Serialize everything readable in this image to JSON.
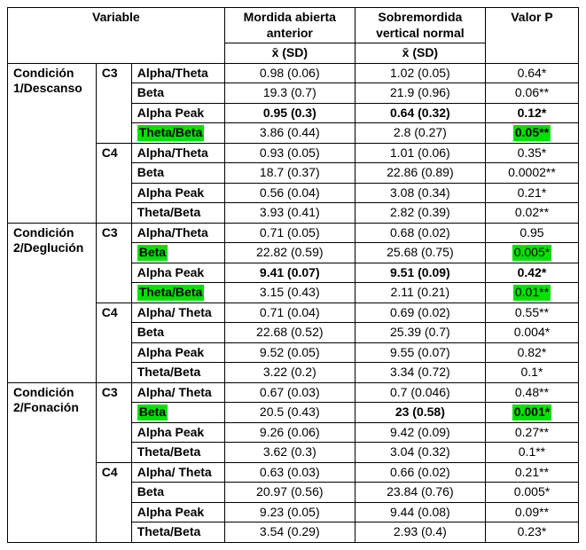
{
  "header": {
    "variable": "Variable",
    "group1_title": "Mordida abierta anterior",
    "group2_title": "Sobremordida vertical normal",
    "pvalue": "Valor P",
    "stat": "x̄ (SD)"
  },
  "conditions": [
    {
      "name": "Condición 1/Descanso",
      "electrodes": [
        {
          "name": "C3",
          "rows": [
            {
              "metric": "Alpha/Theta",
              "v1": "0.98 (0.06)",
              "v2": "1.02 (0.05)",
              "p": "0.64*"
            },
            {
              "metric": "Beta",
              "v1": "19.3 (0.7)",
              "v2": "21.9 (0.96)",
              "p": "0.06**"
            },
            {
              "metric": "Alpha Peak",
              "v1": "0.95 (0.3)",
              "v2": "0.64 (0.32)",
              "p": "0.12*",
              "bold": true
            },
            {
              "metric": "Theta/Beta",
              "v1": "3.86 (0.44)",
              "v2": "2.8 (0.27)",
              "p": "0.05**",
              "hl_metric": true,
              "hl_p": true,
              "bold_p": true
            }
          ]
        },
        {
          "name": "C4",
          "rows": [
            {
              "metric": "Alpha/Theta",
              "v1": "0.93 (0.05)",
              "v2": "1.01 (0.06)",
              "p": "0.35*"
            },
            {
              "metric": "Beta",
              "v1": "18.7 (0.37)",
              "v2": "22.86 (0.89)",
              "p": "0.0002**"
            },
            {
              "metric": "Alpha Peak",
              "v1": "0.56 (0.04)",
              "v2": "3.08 (0.34)",
              "p": "0.21*"
            },
            {
              "metric": "Theta/Beta",
              "v1": "3.93 (0.41)",
              "v2": "2.82 (0.39)",
              "p": "0.02**"
            }
          ]
        }
      ]
    },
    {
      "name": "Condición 2/Deglución",
      "electrodes": [
        {
          "name": "C3",
          "rows": [
            {
              "metric": "Alpha/Theta",
              "v1": "0.71 (0.05)",
              "v2": "0.68 (0.02)",
              "p": "0.95"
            },
            {
              "metric": "Beta",
              "v1": "22.82 (0.59)",
              "v2": "25.68 (0.75)",
              "p": "0.005*",
              "hl_metric": true,
              "hl_p": true
            },
            {
              "metric": "Alpha Peak",
              "v1": "9.41 (0.07)",
              "v2": "9.51 (0.09)",
              "p": "0.42*",
              "bold": true
            },
            {
              "metric": "Theta/Beta",
              "v1": "3.15 (0.43)",
              "v2": "2.11 (0.21)",
              "p": "0.01**",
              "hl_metric": true,
              "hl_p": true
            }
          ]
        },
        {
          "name": "C4",
          "rows": [
            {
              "metric": "Alpha/ Theta",
              "v1": "0.71 (0.04)",
              "v2": "0.69 (0.02)",
              "p": "0.55**"
            },
            {
              "metric": "Beta",
              "v1": "22.68 (0.52)",
              "v2": "25.39 (0.7)",
              "p": "0.004*"
            },
            {
              "metric": "Alpha Peak",
              "v1": "9.52 (0.05)",
              "v2": "9.55 (0.07)",
              "p": "0.82*"
            },
            {
              "metric": "Theta/Beta",
              "v1": "3.22 (0.2)",
              "v2": "3.34 (0.72)",
              "p": "0.1*"
            }
          ]
        }
      ]
    },
    {
      "name": "Condición 2/Fonación",
      "electrodes": [
        {
          "name": "C3",
          "rows": [
            {
              "metric": "Alpha/ Theta",
              "v1": "0.67 (0.03)",
              "v2": "0.7 (0.046)",
              "p": "0.48**"
            },
            {
              "metric": "Beta",
              "v1": "20.5 (0.43)",
              "v2": "23 (0.58)",
              "p": "0.001*",
              "hl_metric": true,
              "hl_p": true,
              "bold_v2": true,
              "bold_p": true
            },
            {
              "metric": "Alpha Peak",
              "v1": "9.26 (0.06)",
              "v2": "9.42 (0.09)",
              "p": "0.27**"
            },
            {
              "metric": "Theta/Beta",
              "v1": "3.62 (0.3)",
              "v2": "3.04 (0.32)",
              "p": "0.1**"
            }
          ]
        },
        {
          "name": "C4",
          "rows": [
            {
              "metric": "Alpha/ Theta",
              "v1": "0.63 (0.03)",
              "v2": "0.66 (0.02)",
              "p": "0.21**"
            },
            {
              "metric": "Beta",
              "v1": "20.97 (0.56)",
              "v2": "23.84 (0.76)",
              "p": "0.005*"
            },
            {
              "metric": "Alpha Peak",
              "v1": "9.23 (0.05)",
              "v2": "9.44 (0.08)",
              "p": "0.09**"
            },
            {
              "metric": "Theta/Beta",
              "v1": "3.54 (0.29)",
              "v2": "2.93 (0.4)",
              "p": "0.23*"
            }
          ]
        }
      ]
    }
  ]
}
